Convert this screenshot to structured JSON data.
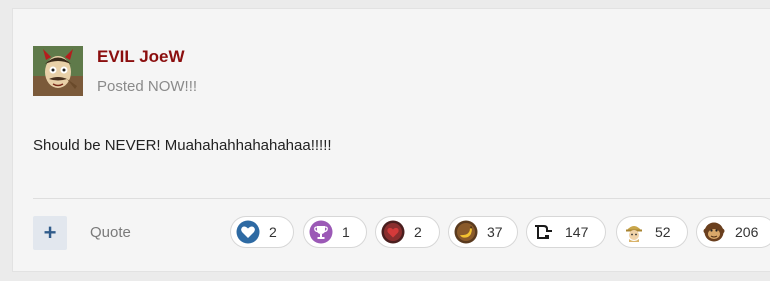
{
  "post": {
    "author": "EVIL JoeW",
    "posted": "Posted NOW!!!",
    "content": "Should be NEVER! Muahahahhahahahaa!!!!!",
    "actions": {
      "plus_label": "+",
      "quote_label": "Quote"
    },
    "reactions": [
      {
        "icon": "heart-icon",
        "count": "2"
      },
      {
        "icon": "trophy-icon",
        "count": "1"
      },
      {
        "icon": "dark-heart-icon",
        "count": "2"
      },
      {
        "icon": "banana-icon",
        "count": "37"
      },
      {
        "icon": "creature-icon",
        "count": "147"
      },
      {
        "icon": "adventurer-icon",
        "count": "52"
      },
      {
        "icon": "monkey-icon",
        "count": "206"
      }
    ]
  },
  "colors": {
    "author": "#8b0e0e",
    "accent": "#2f5b8a"
  }
}
